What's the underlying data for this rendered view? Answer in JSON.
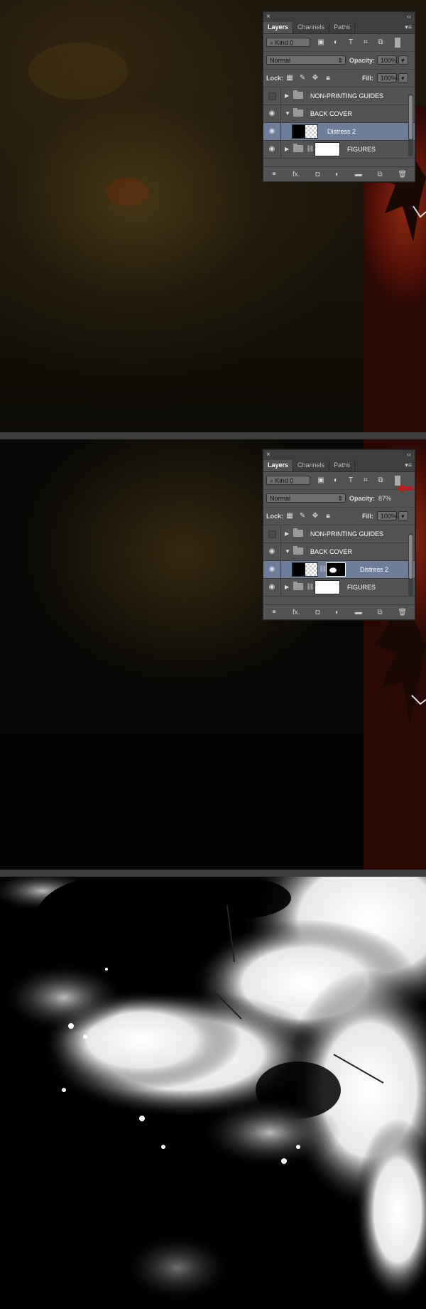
{
  "panel": {
    "tabs": [
      "Layers",
      "Channels",
      "Paths"
    ],
    "filter_kind": "Kind",
    "blend_mode": "Normal",
    "opacity_label": "Opacity:",
    "fill_label": "Fill:",
    "lock_label": "Lock:",
    "fill_value": "100%"
  },
  "shot1": {
    "opacity_value": "100%",
    "layers": [
      {
        "name": "NON-PRINTING GUIDES",
        "visible": false
      },
      {
        "name": "BACK COVER",
        "visible": true
      },
      {
        "name": "Distress 2",
        "visible": true
      },
      {
        "name": "FIGURES",
        "visible": true
      }
    ]
  },
  "shot2": {
    "opacity_value": "87%",
    "layers": [
      {
        "name": "NON-PRINTING GUIDES",
        "visible": false
      },
      {
        "name": "BACK COVER",
        "visible": true
      },
      {
        "name": "Distress 2",
        "visible": true
      },
      {
        "name": "FIGURES",
        "visible": true
      }
    ]
  },
  "icons": {
    "close": "×",
    "collapse": "‹‹",
    "menu": "▾≡",
    "eye": "◉",
    "expand": "▶",
    "expanded": "▼",
    "chain": "⛓",
    "footer": [
      "⚭",
      "fx.",
      "◘",
      "◐",
      "▬",
      "⧉",
      "🗑"
    ]
  },
  "colors": {
    "panel_bg": "#535353",
    "selected_row": "#6d7d9a",
    "arrow": "#b82020"
  }
}
